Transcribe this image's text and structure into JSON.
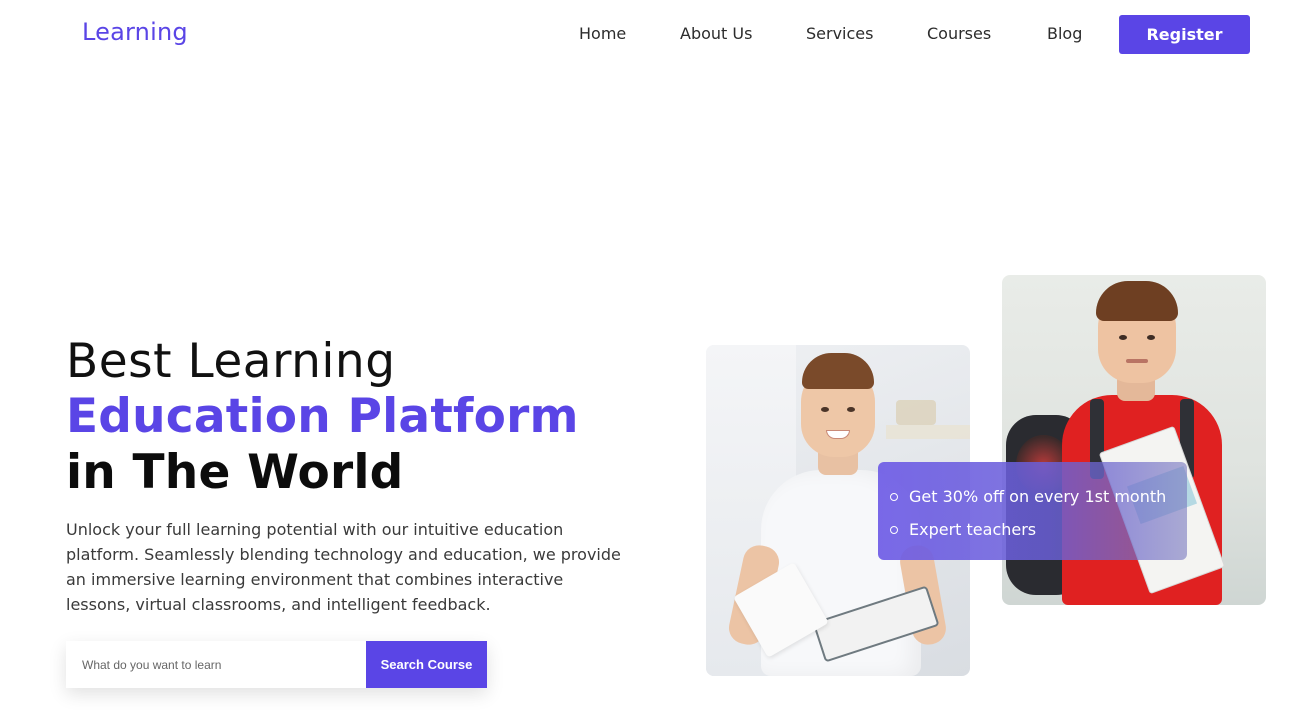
{
  "brand": {
    "logo_text": "Learning"
  },
  "nav": {
    "items": [
      {
        "label": "Home"
      },
      {
        "label": "About Us"
      },
      {
        "label": "Services"
      },
      {
        "label": "Courses"
      },
      {
        "label": "Blog"
      }
    ],
    "register_label": "Register"
  },
  "hero": {
    "title_line1": "Best Learning",
    "title_line2": "Education Platform",
    "title_line3": "in The World",
    "description": "Unlock your full learning potential with our intuitive education platform. Seamlessly blending technology and education, we provide an immersive learning environment that combines interactive lessons, virtual classrooms, and intelligent feedback."
  },
  "search": {
    "placeholder": "What do you want to learn",
    "value": "",
    "button_label": "Search Course"
  },
  "features": {
    "items": [
      {
        "label": "Get 30% off on every 1st month"
      },
      {
        "label": "Expert teachers"
      }
    ]
  },
  "colors": {
    "accent": "#5a45e6",
    "text_dark": "#111111"
  },
  "images": {
    "photo_1": "boy-in-white-shirt-holding-book-photo",
    "photo_2": "boy-in-red-shirt-with-backpack-photo"
  }
}
